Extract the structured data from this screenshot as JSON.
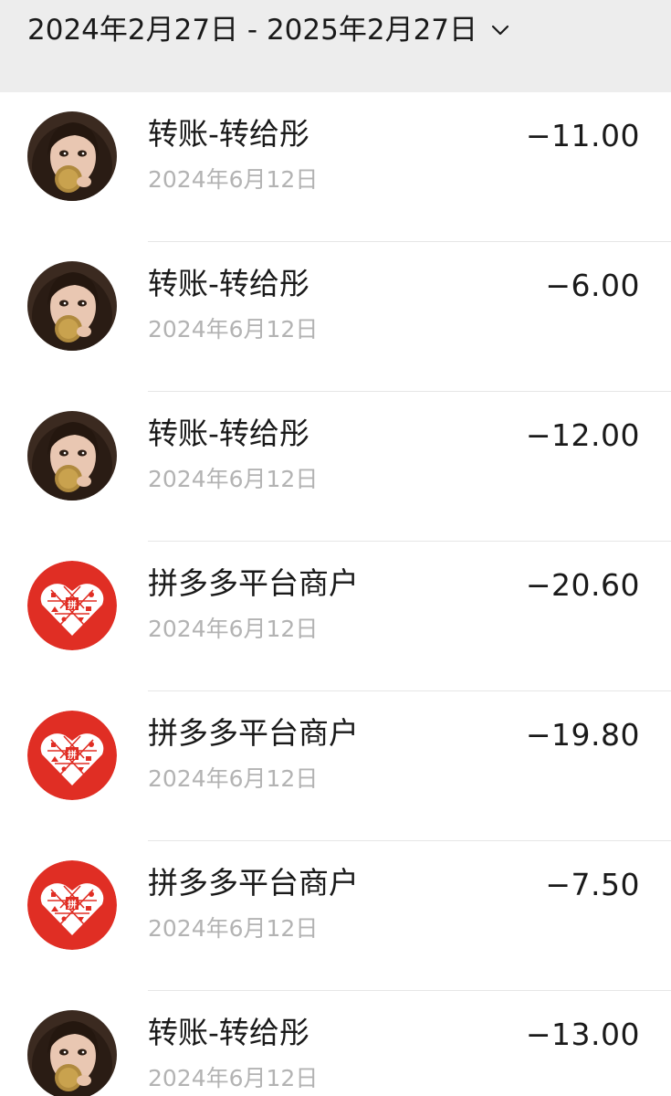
{
  "header": {
    "date_range": "2024年2月27日 - 2025年2月27日",
    "dropdown_icon": "chevron-down-icon"
  },
  "transactions": [
    {
      "name": "转账-转给彤",
      "date": "2024年6月12日",
      "amount": "−11.00",
      "avatar": "person-avatar"
    },
    {
      "name": "转账-转给彤",
      "date": "2024年6月12日",
      "amount": "−6.00",
      "avatar": "person-avatar"
    },
    {
      "name": "转账-转给彤",
      "date": "2024年6月12日",
      "amount": "−12.00",
      "avatar": "person-avatar"
    },
    {
      "name": "拼多多平台商户",
      "date": "2024年6月12日",
      "amount": "−20.60",
      "avatar": "pinduoduo-logo"
    },
    {
      "name": "拼多多平台商户",
      "date": "2024年6月12日",
      "amount": "−19.80",
      "avatar": "pinduoduo-logo"
    },
    {
      "name": "拼多多平台商户",
      "date": "2024年6月12日",
      "amount": "−7.50",
      "avatar": "pinduoduo-logo"
    },
    {
      "name": "转账-转给彤",
      "date": "2024年6月12日",
      "amount": "−13.00",
      "avatar": "person-avatar"
    }
  ],
  "colors": {
    "header_bg": "#ededed",
    "primary_text": "#1a1a1a",
    "secondary_text": "#b3b3b3",
    "brand_red": "#e02e24"
  }
}
